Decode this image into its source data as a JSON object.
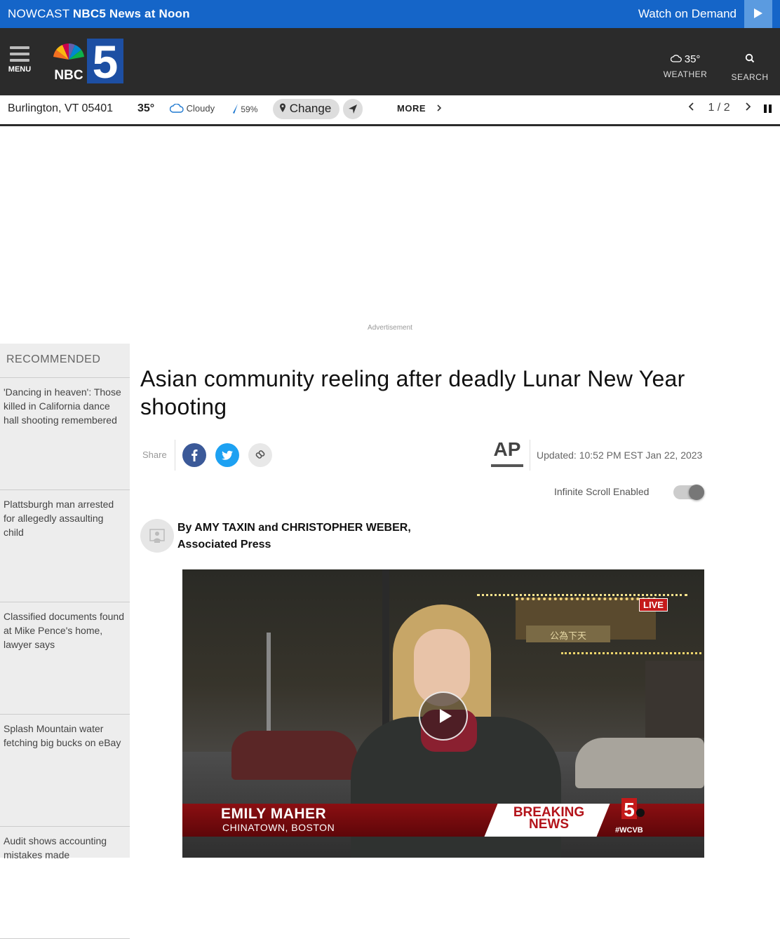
{
  "topbar": {
    "nowcast_prefix": "NOWCAST",
    "nowcast_show": "NBC5 News at Noon",
    "watch": "Watch on Demand"
  },
  "header": {
    "menu_label": "MENU",
    "weather_temp": "35°",
    "weather_label": "WEATHER",
    "search_label": "SEARCH",
    "logo_text": "NBC"
  },
  "location_bar": {
    "city": "Burlington, VT 05401",
    "temp": "35°",
    "condition": "Cloudy",
    "humidity": "59%",
    "change_label": "Change",
    "more_label": "MORE",
    "pager": "1 / 2"
  },
  "ad": {
    "label": "Advertisement"
  },
  "sidebar": {
    "heading": "RECOMMENDED",
    "items": [
      {
        "label": "'Dancing in heaven': Those killed in California dance hall shooting remembered"
      },
      {
        "label": "Plattsburgh man arrested for allegedly assaulting child"
      },
      {
        "label": "Classified documents found at Mike Pence's home, lawyer says"
      },
      {
        "label": "Splash Mountain water fetching big bucks on eBay"
      },
      {
        "label": "Audit shows accounting mistakes made"
      }
    ]
  },
  "article": {
    "title": "Asian community reeling after deadly Lunar New Year shooting",
    "share_label": "Share",
    "source_logo": "AP",
    "updated": "Updated: 10:52 PM EST Jan 22, 2023",
    "infinite_scroll": "Infinite Scroll Enabled",
    "infinite_scroll_on": true,
    "byline": "By AMY TAXIN and CHRISTOPHER WEBER, Associated Press"
  },
  "video": {
    "live_badge": "LIVE",
    "reporter_name": "EMILY MAHER",
    "reporter_location": "CHINATOWN, BOSTON",
    "breaking_line1": "BREAKING",
    "breaking_line2": "NEWS",
    "station_tag": "#WCVB",
    "station_number": "5",
    "sign_text": "公為下天"
  },
  "colors": {
    "topbar_blue": "#1565c8",
    "header_dark": "#2b2b2b",
    "sidebar_bg": "#ededed",
    "facebook": "#3b5998",
    "twitter": "#1da1f2",
    "breaking_red": "#b3131a"
  }
}
